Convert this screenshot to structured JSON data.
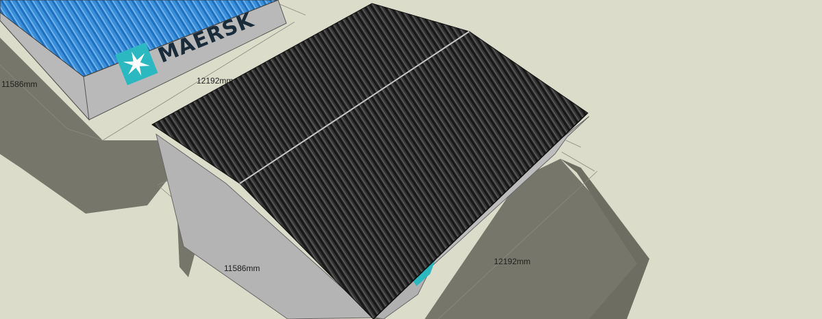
{
  "container": {
    "brand": "MAERSK",
    "logo": "maersk-star-logo",
    "colors": {
      "roof_blue": "#2f86d4",
      "wall_grey": "#b9b9b9",
      "logo_teal": "#2bb8c0"
    }
  },
  "shelter": {
    "roof_color": "#2b2b2b",
    "ground_color": "#dcdccb",
    "shadow_color": "#76766a"
  },
  "dimensions": {
    "top_container_width": "11586mm",
    "top_container_length": "12192mm",
    "shelter_width": "11586mm",
    "shelter_length": "12192mm"
  }
}
